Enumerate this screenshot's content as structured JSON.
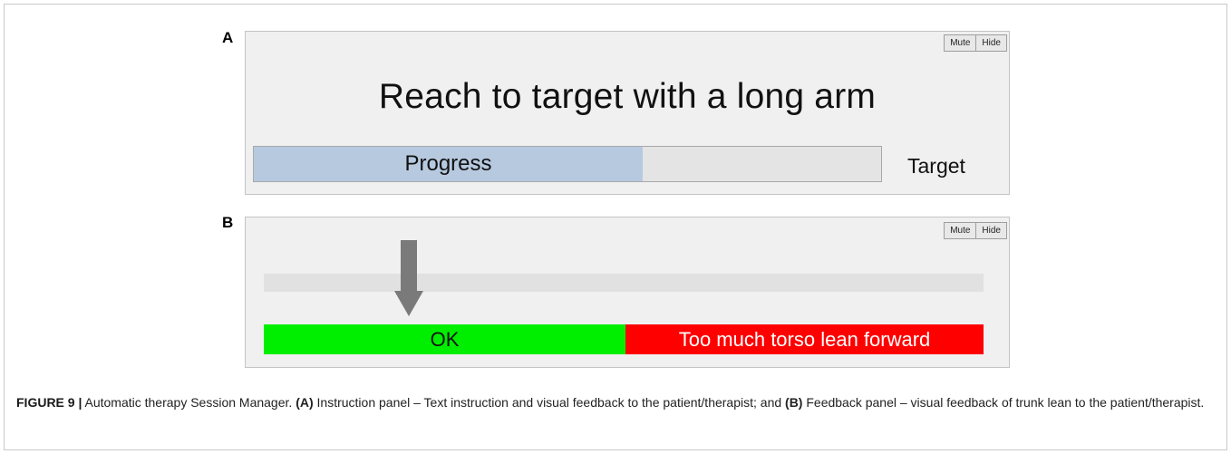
{
  "panel_a": {
    "label": "A",
    "buttons": {
      "mute": "Mute",
      "hide": "Hide"
    },
    "instruction": "Reach to target with a long arm",
    "progress": {
      "label": "Progress",
      "fraction": 0.62,
      "fill_color": "#b6c9df"
    },
    "target_label": "Target"
  },
  "panel_b": {
    "label": "B",
    "buttons": {
      "mute": "Mute",
      "hide": "Hide"
    },
    "indicator_icon": "down-arrow-icon",
    "zones": {
      "ok": {
        "label": "OK",
        "color": "#00ee00"
      },
      "bad": {
        "label": "Too much torso lean forward",
        "color": "#ff0000"
      }
    }
  },
  "caption": {
    "figure": "FIGURE 9 |",
    "intro": " Automatic therapy Session Manager. ",
    "a_ref": "(A)",
    "a_text": " Instruction panel – Text instruction and visual feedback to the patient/therapist; and ",
    "b_ref": "(B)",
    "b_text": " Feedback panel – visual feedback of trunk lean to the patient/therapist."
  }
}
